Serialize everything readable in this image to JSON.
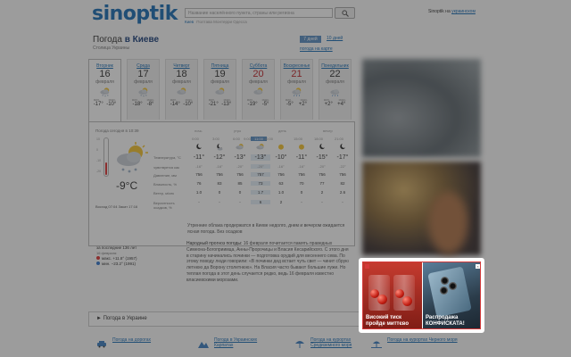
{
  "header": {
    "logo": "sinoptik",
    "search_placeholder": "Название населённого пункта, страны или региона",
    "examples_label": "Киев",
    "examples": "Полтава  Монтерри  Одесса",
    "top_right_text": "Sinoptik на",
    "top_right_link": "украинском"
  },
  "city": {
    "title_prefix": "Погода",
    "title_city": "в Киеве",
    "region": "Столица Украины",
    "period_active": "7 дней",
    "period_link": "10 дней",
    "map_link": "погода на карте"
  },
  "days": [
    {
      "name": "Вторник",
      "num": "16",
      "month": "февраля",
      "min": "-17°",
      "max": "-10°",
      "icon": "sun-cloud-snow-icon",
      "red": false,
      "active": true
    },
    {
      "name": "Среда",
      "num": "17",
      "month": "февраля",
      "min": "-18°",
      "max": "-8°",
      "icon": "sun-cloud-snow-icon",
      "red": false,
      "active": false
    },
    {
      "name": "Четверг",
      "num": "18",
      "month": "февраля",
      "min": "-14°",
      "max": "-10°",
      "icon": "sun-cloud-icon",
      "red": false,
      "active": false
    },
    {
      "name": "Пятница",
      "num": "19",
      "month": "февраля",
      "min": "-21°",
      "max": "-13°",
      "icon": "sun-cloud-icon",
      "red": false,
      "active": false
    },
    {
      "name": "Суббота",
      "num": "20",
      "month": "февраля",
      "min": "-19°",
      "max": "-5°",
      "icon": "sun-cloud-icon",
      "red": true,
      "active": false
    },
    {
      "name": "Воскресенье",
      "num": "21",
      "month": "февраля",
      "min": "-5°",
      "max": "+2°",
      "icon": "sun-cloud-rain-icon",
      "red": true,
      "active": false
    },
    {
      "name": "Понедельник",
      "num": "22",
      "month": "февраля",
      "min": "+2°",
      "max": "+4°",
      "icon": "cloud-rain-icon",
      "red": false,
      "active": false
    }
  ],
  "day_labels": {
    "min": "мин.",
    "max": "макс."
  },
  "now": {
    "label": "Погода сегодня в 10:39",
    "temp": "-9°C",
    "sunrise": "Восход 07:04",
    "sunset": "Закат 17:16",
    "thermo_level": 0.33,
    "scale": [
      "10",
      "0",
      "-10",
      "-20"
    ]
  },
  "periods": [
    "ночь",
    "утро",
    "день",
    "вечер"
  ],
  "times": [
    "0:00",
    "3:00",
    "6:00",
    "9:00",
    "11:00",
    "12:00",
    "15:00",
    "18:00",
    "21:00"
  ],
  "active_time_index": 4,
  "row_labels": {
    "temp": "Температура, °C",
    "feels": "чувствуется как",
    "pressure": "Давление, мм",
    "humidity": "Влажность, %",
    "wind": "Ветер, м/сек",
    "precip": "Вероятность осадков, %"
  },
  "hourly": {
    "temp": [
      "-11°",
      "-12°",
      "-13°",
      "-13°",
      "-10°",
      "-11°",
      "-15°",
      "-17°"
    ],
    "feels": [
      "-16°",
      "-16°",
      "-20°",
      "-20°",
      "-16°",
      "-16°",
      "-20°",
      "-22°"
    ],
    "pressure": [
      "756",
      "756",
      "756",
      "757",
      "756",
      "756",
      "756",
      "756"
    ],
    "humidity": [
      "76",
      "83",
      "85",
      "73",
      "63",
      "70",
      "77",
      "82"
    ],
    "wind": [
      "1.0",
      "0",
      "0",
      "1.7",
      "1.0",
      "0",
      "2",
      "2.6"
    ],
    "precip": [
      "-",
      "-",
      "-",
      "6",
      "2",
      "-",
      "-",
      "-"
    ]
  },
  "description": "Утренние облака продержатся в Киеве недолго, днем и вечером ожидается ясная погода. Без осадков",
  "folk": {
    "label": "Народный прогноз погоды:",
    "text": "16 февраля почитается память праведных Симеона-Богоприимца, Анны-Пророчицы и Власия Кесарийского. С этого дня в старину начинались починки — подготовка орудий для весеннего сева. По этому поводу люди говорили: «В починки дед встает чуть свет — чинит сбрую летнюю да Ворону столетнюю». На Власия часто бывают большие лужи. Но теплая погода в этот день случается редко, ведь 16 февраля известно власиевскими морозами."
  },
  "history": {
    "title": "за последние 136 лет",
    "sub": "16 февраля:",
    "max": "макс. +11.8° (1957)",
    "min": "мин. −23.2° (1991)"
  },
  "ukraine_bar": "Погода в Украине",
  "footer": [
    {
      "label": "Погода на дорогах",
      "icon": "car-icon"
    },
    {
      "label": "Погода в Украинских Карпатах",
      "icon": "mountain-icon"
    },
    {
      "label": "Погода на курортах Средиземного моря",
      "icon": "umbrella-icon"
    },
    {
      "label": "Погода на курортах Черного моря",
      "icon": "beach-icon"
    }
  ],
  "ad": {
    "left_text": "Високий тиск пройде миттєво",
    "right_text": "Распродажа КОНФИСКАТА!"
  },
  "colors": {
    "brand": "#1a6db5",
    "red_day": "#c0262b",
    "active_tab": "#5a8fc4",
    "ad_border": "#d43a3a"
  }
}
